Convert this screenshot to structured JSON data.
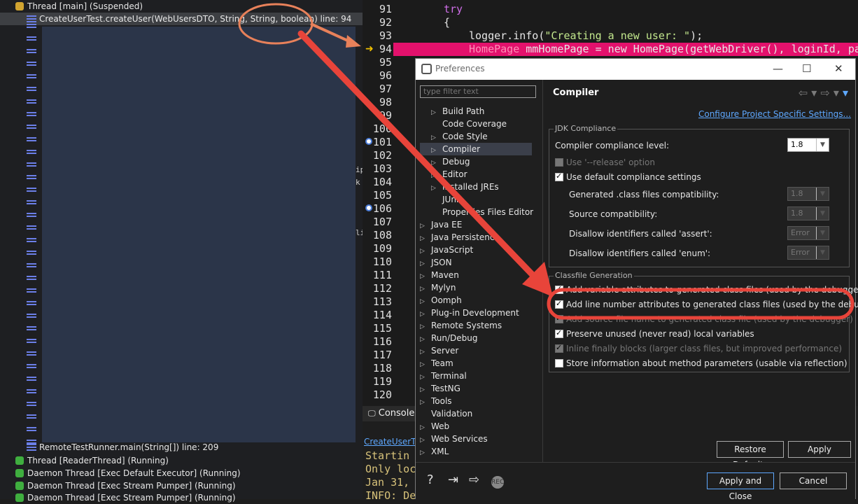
{
  "debug_tree": {
    "thread_main": "Thread [main] (Suspended)",
    "selected_frame": "CreateUserTest.createUser(WebUsersDTO, String, String, boolean) line: 94",
    "partial_frame": "CreateUserTest…",
    "bottom_frame": "RemoteTestRunner.main(String[]) line: 209",
    "threads": [
      "Thread [ReaderThread] (Running)",
      "Daemon Thread [Exec Default Executor] (Running)",
      "Daemon Thread [Exec Stream Pumper] (Running)",
      "Daemon Thread [Exec Stream Pumper] (Running)"
    ],
    "edge_glyphs": [
      "ip",
      "k",
      "li"
    ]
  },
  "editor": {
    "line_numbers": [
      "91",
      "92",
      "93",
      "94",
      "95",
      "96",
      "97",
      "98",
      "99",
      "100",
      "101",
      "102",
      "103",
      "104",
      "105",
      "106",
      "107",
      "108",
      "109",
      "110",
      "111",
      "112",
      "113",
      "114",
      "115",
      "116",
      "117",
      "118",
      "119",
      "120"
    ],
    "code_try": "try",
    "code_brace": "{",
    "code_logger": "logger.info(",
    "code_logger_str": "\"Creating a new user: \"",
    "code_logger_end": ");",
    "code_94_a": "HomePage",
    "code_94_b": " mmHomePage = new HomePage(getWebDriver(), loginId, pa"
  },
  "console": {
    "tab": "Console",
    "link": "CreateUserTes",
    "lines": [
      "Startin",
      "Only loc",
      "Jan 31,",
      "INFO: De"
    ]
  },
  "dialog": {
    "title": "Preferences",
    "filter_placeholder": "type filter text",
    "tree_children": [
      {
        "label": "Build Path",
        "arrow": "▷"
      },
      {
        "label": "Code Coverage",
        "arrow": ""
      },
      {
        "label": "Code Style",
        "arrow": "▷"
      },
      {
        "label": "Compiler",
        "arrow": "▷"
      },
      {
        "label": "Debug",
        "arrow": "▷"
      },
      {
        "label": "Editor",
        "arrow": "▷"
      },
      {
        "label": "Installed JREs",
        "arrow": "▷"
      },
      {
        "label": "JUnit",
        "arrow": ""
      },
      {
        "label": "Properties Files Editor",
        "arrow": ""
      }
    ],
    "tree_roots": [
      {
        "label": "Java EE",
        "arrow": "▷"
      },
      {
        "label": "Java Persistence",
        "arrow": "▷"
      },
      {
        "label": "JavaScript",
        "arrow": "▷"
      },
      {
        "label": "JSON",
        "arrow": "▷"
      },
      {
        "label": "Maven",
        "arrow": "▷"
      },
      {
        "label": "Mylyn",
        "arrow": "▷"
      },
      {
        "label": "Oomph",
        "arrow": "▷"
      },
      {
        "label": "Plug-in Development",
        "arrow": "▷"
      },
      {
        "label": "Remote Systems",
        "arrow": "▷"
      },
      {
        "label": "Run/Debug",
        "arrow": "▷"
      },
      {
        "label": "Server",
        "arrow": "▷"
      },
      {
        "label": "Team",
        "arrow": "▷"
      },
      {
        "label": "Terminal",
        "arrow": "▷"
      },
      {
        "label": "TestNG",
        "arrow": "▷"
      },
      {
        "label": "Tools",
        "arrow": "▷"
      },
      {
        "label": "Validation",
        "arrow": ""
      },
      {
        "label": "Web",
        "arrow": "▷"
      },
      {
        "label": "Web Services",
        "arrow": "▷"
      },
      {
        "label": "XML",
        "arrow": "▷"
      }
    ],
    "panel_title": "Compiler",
    "configure_link": "Configure Project Specific Settings...",
    "jdk_group": "JDK Compliance",
    "compliance_label": "Compiler compliance level:",
    "compliance_value": "1.8",
    "release_option": "Use '--release' option",
    "default_compliance": "Use default compliance settings",
    "generated_compat": "Generated .class files compatibility:",
    "generated_value": "1.8",
    "source_compat": "Source compatibility:",
    "source_value": "1.8",
    "disallow_assert": "Disallow identifiers called 'assert':",
    "assert_value": "Error",
    "disallow_enum": "Disallow identifiers called 'enum':",
    "enum_value": "Error",
    "classfile_group": "Classfile Generation",
    "classfile_opts": [
      {
        "label": "Add variable attributes to generated class files (used by the debugger)",
        "checked": true,
        "disabled": false
      },
      {
        "label": "Add line number attributes to generated class files (used by the debugger)",
        "checked": true,
        "disabled": false
      },
      {
        "label": "Add source file name to generated class file (used by the debugger)",
        "checked": true,
        "disabled": true
      },
      {
        "label": "Preserve unused (never read) local variables",
        "checked": true,
        "disabled": false
      },
      {
        "label": "Inline finally blocks (larger class files, but improved performance)",
        "checked": true,
        "disabled": true
      },
      {
        "label": "Store information about method parameters (usable via reflection)",
        "checked": false,
        "disabled": false
      }
    ],
    "restore_defaults": "Restore Defaults",
    "apply": "Apply",
    "apply_and_close": "Apply and Close",
    "cancel": "Cancel",
    "footer_rec": "REC"
  },
  "colors": {
    "annotation": "#e8443a",
    "annotation_orange": "#e8815a",
    "highlight_line": "#e3116c"
  }
}
